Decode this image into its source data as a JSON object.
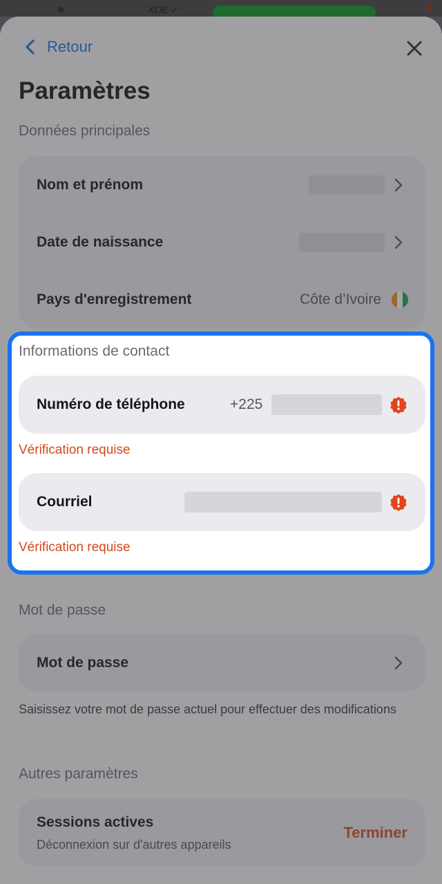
{
  "status_bar": {
    "carrier": "XOE ✓"
  },
  "header": {
    "back_label": "Retour",
    "title": "Paramètres"
  },
  "main_data": {
    "section_title": "Données principales",
    "rows": [
      {
        "label": "Nom et prénom",
        "value": ""
      },
      {
        "label": "Date de naissance",
        "value": ""
      },
      {
        "label": "Pays d'enregistrement",
        "value": "Côte d’Ivoire"
      }
    ]
  },
  "contact": {
    "section_title": "Informations de contact",
    "phone": {
      "label": "Numéro de téléphone",
      "prefix": "+225",
      "status": "Vérification requise"
    },
    "email": {
      "label": "Courriel",
      "status": "Vérification requise"
    }
  },
  "password": {
    "section_title": "Mot de passe",
    "label": "Mot de passe",
    "helper": "Saisissez votre mot de passe actuel pour effectuer des modifications"
  },
  "other": {
    "section_title": "Autres paramètres",
    "sessions": {
      "label": "Sessions actives",
      "subtitle": "Déconnexion sur d'autres appareils",
      "action": "Terminer"
    }
  },
  "colors": {
    "accent": "#1e6fd9",
    "highlight": "#1a73f0",
    "warning": "#d24a1c",
    "flag_orange": "#f18a1f",
    "flag_green": "#1f9a52"
  }
}
